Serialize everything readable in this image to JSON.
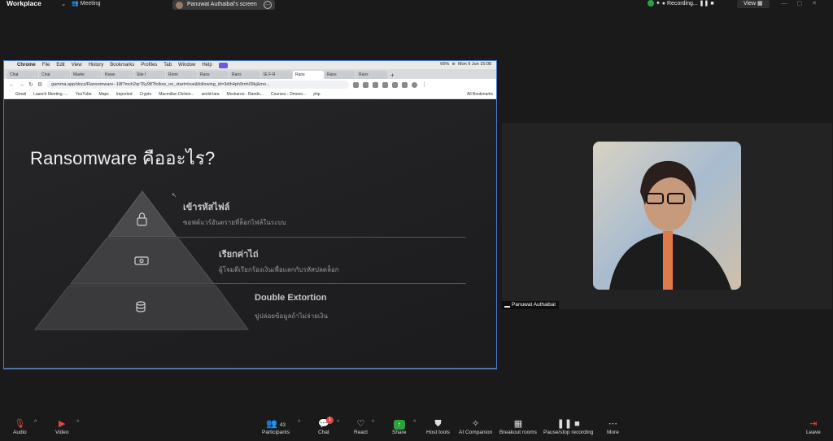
{
  "zoom": {
    "brand": "Workplace",
    "meeting_label": "Meeting",
    "share_banner": "Panuwat Authaibal's screen",
    "recording_label": "Recording...",
    "view_label": "View"
  },
  "mac_menu": {
    "items": [
      "Chrome",
      "File",
      "Edit",
      "View",
      "History",
      "Bookmarks",
      "Profiles",
      "Tab",
      "Window",
      "Help"
    ],
    "battery": "66%",
    "datetime": "Mon 9 Jun  15:08"
  },
  "browser": {
    "tabs": [
      "Chat",
      "Chat",
      "Marke",
      "Kwan",
      "Site I",
      "Romi",
      "Rans",
      "Rans",
      "IE F-R",
      "Rans",
      "Rans",
      "Rans"
    ],
    "url": "gamma.app/docs/Ransomware--18f7mch2qr76y98?follow_on_start=true&following_id=3dih4ph9mh09kj&mo...",
    "bookmarks": [
      "Gmail",
      "Launch Meeting -...",
      "YouTube",
      "Maps",
      "Imported",
      "Crypto",
      "Macmillan Diction...",
      "world-lara",
      "Mockaroo - Rando...",
      "Courses - Omexo...",
      "php",
      "All Bookmarks"
    ]
  },
  "slide": {
    "title": "Ransomware คืออะไร?",
    "levels": [
      {
        "title": "เข้ารหัสไฟล์",
        "desc": "ซอฟต์แวร์อันตรายที่ล็อกไฟล์ในระบบ",
        "icon": "lock-icon"
      },
      {
        "title": "เรียกค่าไถ่",
        "desc": "ผู้โจมตีเรียกร้องเงินเพื่อแลกกับรหัสปลดล็อก",
        "icon": "money-icon"
      },
      {
        "title": "Double Extortion",
        "desc": "ขู่ปล่อยข้อมูลถ้าไม่จ่ายเงิน",
        "icon": "database-icon"
      }
    ]
  },
  "participant": {
    "name": "Panuwat Authaibal"
  },
  "toolbar": {
    "audio": "Audio",
    "video": "Video",
    "participants": "Participants",
    "participants_count": "43",
    "chat": "Chat",
    "chat_badge": "1",
    "react": "React",
    "share": "Share",
    "host_tools": "Host tools",
    "ai_companion": "AI Companion",
    "breakout": "Breakout rooms",
    "recording": "Pause/stop recording",
    "more": "More",
    "leave": "Leave"
  },
  "colors": {
    "accent_red": "#e0463f",
    "share_green": "#29a33d",
    "slide_bg": "#1f1f21"
  }
}
